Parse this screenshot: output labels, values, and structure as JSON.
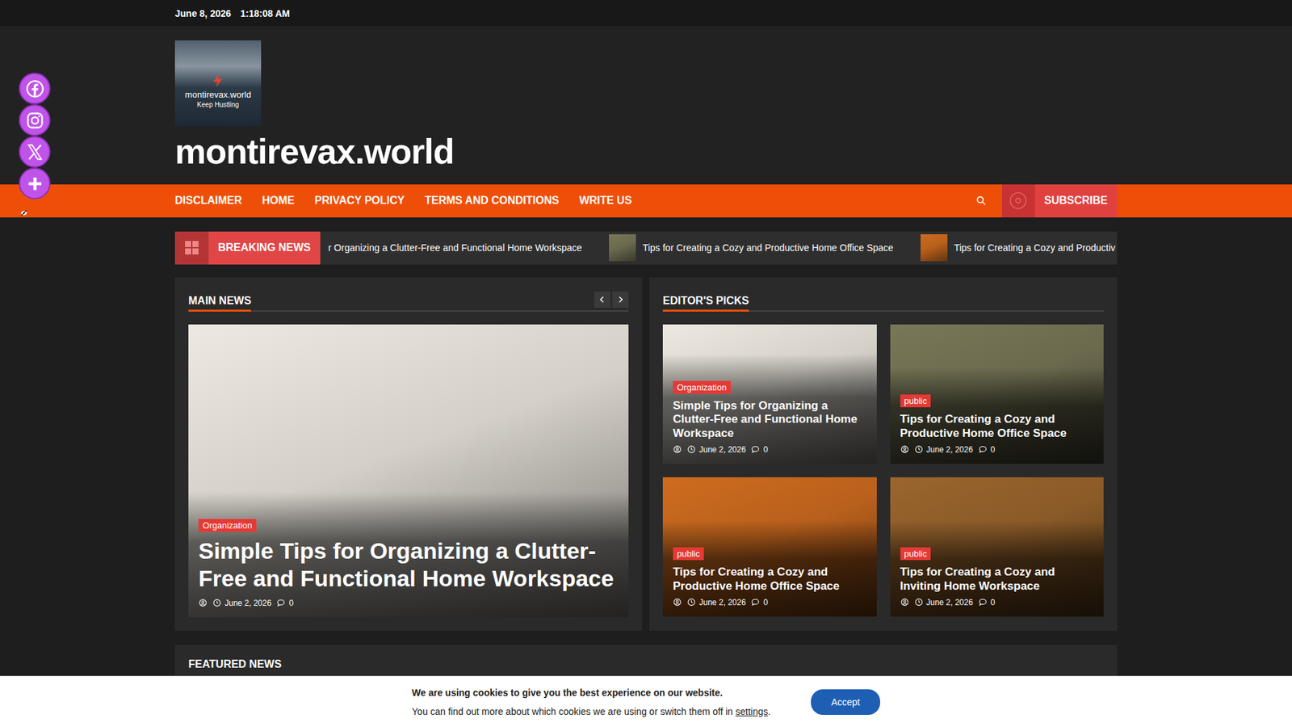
{
  "topbar": {
    "date": "June 8, 2026",
    "time": "1:18:08 AM"
  },
  "logo": {
    "name": "montirevax.world",
    "tagline": "Keep Hustling"
  },
  "site_title": "montirevax.world",
  "nav": [
    "DISCLAIMER",
    "HOME",
    "PRIVACY POLICY",
    "TERMS AND CONDITIONS",
    "WRITE US"
  ],
  "subscribe": "SUBSCRIBE",
  "breaking": {
    "label": "BREAKING NEWS",
    "items": [
      {
        "title": "r Organizing a Clutter-Free and Functional Home Workspace",
        "thumb": false,
        "color": "#cfc7b8"
      },
      {
        "title": "Tips for Creating a Cozy and Productive Home Office Space",
        "thumb": true,
        "color": "#6b6a4e"
      },
      {
        "title": "Tips for Creating a Cozy and Productiv",
        "thumb": true,
        "color": "#b8601c"
      }
    ]
  },
  "main_news": {
    "title": "MAIN NEWS",
    "article": {
      "category": "Organization",
      "title": "Simple Tips for Organizing a Clutter-Free and Functional Home Workspace",
      "date": "June 2, 2026",
      "comments": "0",
      "color": "#d4d0c8"
    }
  },
  "editors_picks": {
    "title": "EDITOR'S PICKS",
    "items": [
      {
        "category": "Organization",
        "title": "Simple Tips for Organizing a Clutter-Free and Functional Home Workspace",
        "date": "June 2, 2026",
        "comments": "0",
        "color": "#d4d0c8"
      },
      {
        "category": "public",
        "title": "Tips for Creating a Cozy and Productive Home Office Space",
        "date": "June 2, 2026",
        "comments": "0",
        "color": "#6b6a4e"
      },
      {
        "category": "public",
        "title": "Tips for Creating a Cozy and Productive Home Office Space",
        "date": "June 2, 2026",
        "comments": "0",
        "color": "#b8601c"
      },
      {
        "category": "public",
        "title": "Tips for Creating a Cozy and Inviting Home Workspace",
        "date": "June 2, 2026",
        "comments": "0",
        "color": "#8a5a28"
      }
    ]
  },
  "featured": {
    "title": "FEATURED NEWS"
  },
  "cookie": {
    "line1": "We are using cookies to give you the best experience on our website.",
    "line2": "You can find out more about which cookies we are using or switch them off in ",
    "link": "settings",
    "line2_end": ".",
    "button": "Accept"
  }
}
